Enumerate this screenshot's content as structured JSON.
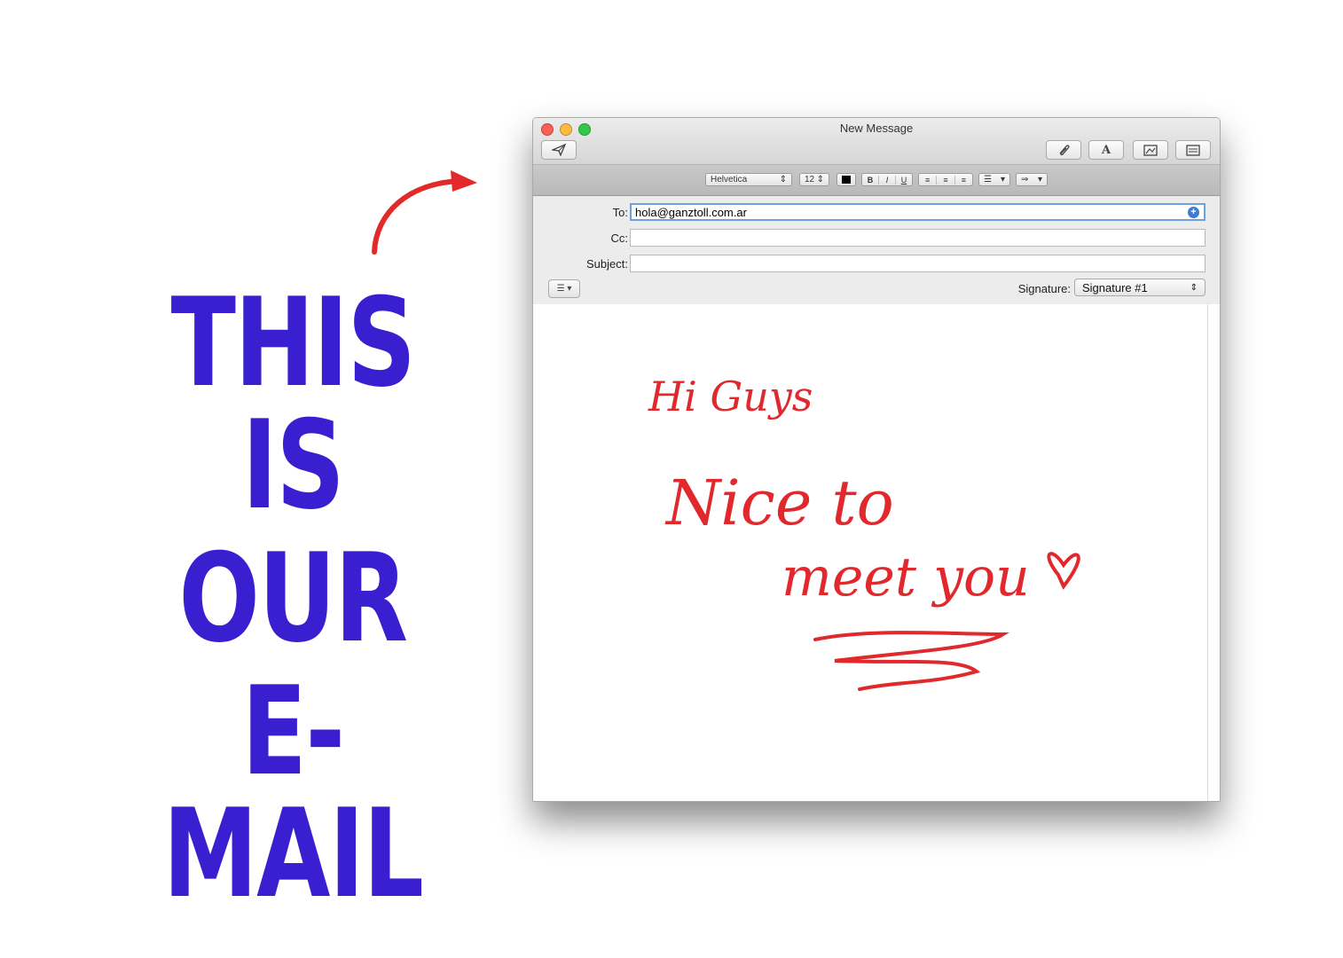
{
  "headline": {
    "line1": "THIS IS",
    "line2": "OUR",
    "line3": "E-MAIL",
    "color": "#3a1fd0",
    "arrow_color": "#e32a2a"
  },
  "window": {
    "title": "New Message",
    "toolbar": {
      "send_icon": "paper-plane-icon",
      "attach_icon": "paperclip-icon",
      "font_label": "A",
      "photo_icon": "photo-browser-icon",
      "format_icon": "stationery-icon"
    },
    "format_bar": {
      "font": "Helvetica",
      "size": "12",
      "bold": "B",
      "italic": "I",
      "underline": "U"
    },
    "header": {
      "to_label": "To:",
      "to_value": "hola@ganztoll.com.ar",
      "cc_label": "Cc:",
      "cc_value": "",
      "subject_label": "Subject:",
      "subject_value": "",
      "signature_label": "Signature:",
      "signature_value": "Signature #1"
    },
    "body": {
      "line1": "Hi Guys",
      "line2": "Nice to",
      "line3": "meet you",
      "ink_color": "#e0282d"
    }
  }
}
